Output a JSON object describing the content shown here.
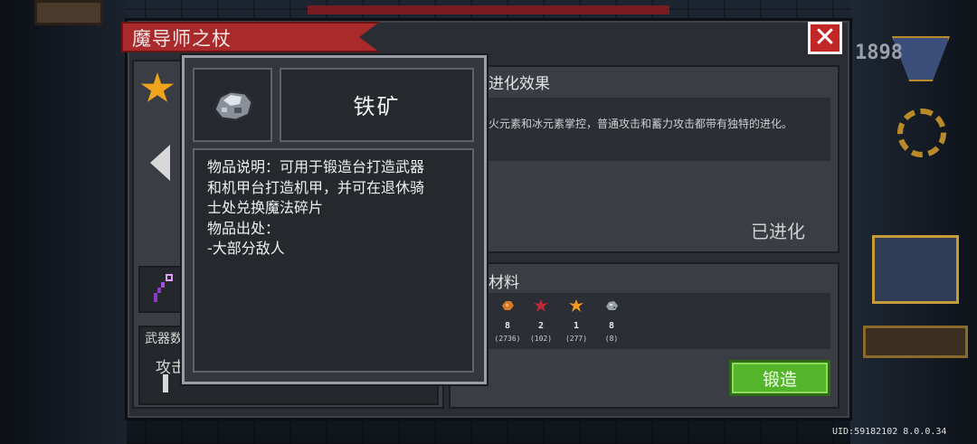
{
  "window": {
    "title": "魔导师之杖",
    "close_label": "✕"
  },
  "background": {
    "digits": "1898"
  },
  "left_panel": {
    "stats_label": "武器数",
    "attack_label": "攻击"
  },
  "evolution": {
    "title": "进化效果",
    "description": "火元素和冰元素掌控，普通攻击和蓄力攻击都带有独特的进化。",
    "status": "已进化"
  },
  "materials": {
    "title": "材料",
    "items": [
      {
        "icon": "ore-copper-icon",
        "color": "#d47a2a",
        "count": "8",
        "total": "(2736)"
      },
      {
        "icon": "red-leaf-icon",
        "color": "#c4283a",
        "count": "2",
        "total": "(102)"
      },
      {
        "icon": "orange-leaf-icon",
        "color": "#f09a26",
        "count": "1",
        "total": "(277)"
      },
      {
        "icon": "iron-ore-icon",
        "color": "#9aa0a8",
        "count": "8",
        "total": "(8)"
      }
    ],
    "forge_label": "锻造"
  },
  "popup": {
    "item_icon": "iron-ore-icon",
    "item_name": "铁矿",
    "description": "物品说明：可用于锻造台打造武器\n和机甲台打造机甲，并可在退休骑\n士处兑换魔法碎片\n物品出处：\n-大部分敌人"
  },
  "footer": {
    "uid": "UID:59182102 8.0.0.34"
  }
}
